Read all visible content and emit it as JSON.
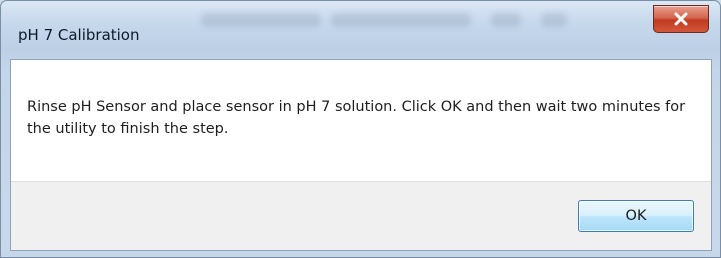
{
  "window": {
    "title": "pH 7 Calibration"
  },
  "dialog": {
    "message": "Rinse pH Sensor and place sensor in pH 7 solution. Click OK and then wait two minutes for the utility to finish the step.",
    "ok_label": "OK"
  },
  "icons": {
    "close": "close-icon"
  },
  "colors": {
    "close_button": "#c7402a",
    "ok_button_border": "#3c7fb1",
    "button_area": "#f0f0f0",
    "frame": "#c6d8ec"
  }
}
